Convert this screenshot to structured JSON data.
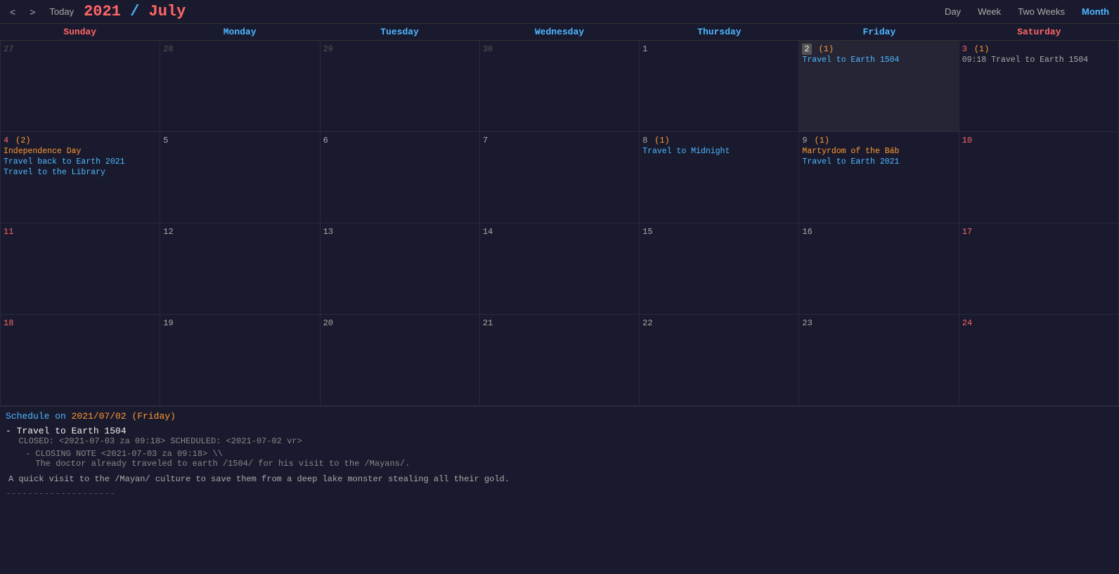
{
  "header": {
    "title_year": "2021",
    "title_sep": " / ",
    "title_month": "July",
    "nav_prev": "<",
    "nav_next": ">",
    "today_label": "Today",
    "views": [
      "Day",
      "Week",
      "Two Weeks",
      "Month"
    ],
    "active_view": "Month"
  },
  "day_headers": [
    {
      "label": "Sunday",
      "type": "sunday"
    },
    {
      "label": "Monday",
      "type": "weekday"
    },
    {
      "label": "Tuesday",
      "type": "weekday"
    },
    {
      "label": "Wednesday",
      "type": "weekday"
    },
    {
      "label": "Thursday",
      "type": "weekday"
    },
    {
      "label": "Friday",
      "type": "weekday"
    },
    {
      "label": "Saturday",
      "type": "saturday"
    }
  ],
  "weeks": [
    {
      "days": [
        {
          "num": "27",
          "type": "prev-month",
          "events": []
        },
        {
          "num": "28",
          "type": "prev-month",
          "events": []
        },
        {
          "num": "29",
          "type": "prev-month",
          "events": []
        },
        {
          "num": "30",
          "type": "prev-month",
          "events": []
        },
        {
          "num": "1",
          "type": "thursday",
          "events": []
        },
        {
          "num": "2",
          "count": "(1)",
          "type": "friday-highlight",
          "events": [
            {
              "text": "Travel to Earth 1504",
              "style": "normal"
            }
          ]
        },
        {
          "num": "3",
          "count": "(1)",
          "type": "saturday",
          "events": [
            {
              "text": "09:18 Travel to Earth 1504",
              "style": "timed"
            }
          ]
        }
      ]
    },
    {
      "days": [
        {
          "num": "4",
          "count": "(2)",
          "type": "sunday",
          "events": [
            {
              "text": "Independence Day",
              "style": "holiday"
            },
            {
              "text": "Travel back to Earth 2021",
              "style": "normal"
            },
            {
              "text": "Travel to the Library",
              "style": "normal"
            }
          ]
        },
        {
          "num": "5",
          "type": "monday",
          "events": []
        },
        {
          "num": "6",
          "type": "tuesday",
          "events": []
        },
        {
          "num": "7",
          "type": "wednesday",
          "events": []
        },
        {
          "num": "8",
          "count": "(1)",
          "type": "thursday",
          "events": [
            {
              "text": "Travel to Midnight",
              "style": "normal"
            }
          ]
        },
        {
          "num": "9",
          "count": "(1)",
          "type": "friday",
          "events": [
            {
              "text": "Martyrdom of the Báb",
              "style": "holiday"
            },
            {
              "text": "Travel to Earth 2021",
              "style": "normal"
            }
          ]
        },
        {
          "num": "10",
          "type": "saturday",
          "events": []
        }
      ]
    },
    {
      "days": [
        {
          "num": "11",
          "type": "sunday",
          "events": []
        },
        {
          "num": "12",
          "type": "monday",
          "events": []
        },
        {
          "num": "13",
          "type": "tuesday",
          "events": []
        },
        {
          "num": "14",
          "type": "wednesday",
          "events": []
        },
        {
          "num": "15",
          "type": "thursday",
          "events": []
        },
        {
          "num": "16",
          "type": "friday",
          "events": []
        },
        {
          "num": "17",
          "type": "saturday",
          "events": []
        }
      ]
    },
    {
      "days": [
        {
          "num": "18",
          "type": "sunday",
          "events": []
        },
        {
          "num": "19",
          "type": "monday",
          "events": []
        },
        {
          "num": "20",
          "type": "tuesday",
          "events": []
        },
        {
          "num": "21",
          "type": "wednesday",
          "events": []
        },
        {
          "num": "22",
          "type": "thursday",
          "events": []
        },
        {
          "num": "23",
          "type": "friday",
          "events": []
        },
        {
          "num": "24",
          "type": "saturday",
          "events": []
        }
      ]
    }
  ],
  "schedule": {
    "title": "Schedule on 2021/07/02 (Friday)",
    "entries": [
      {
        "title": "- Travel to Earth 1504",
        "meta": "CLOSED: <2021-07-03 za 09:18> SCHEDULED: <2021-07-02 vr>",
        "note": "- CLOSING NOTE <2021-07-03 za 09:18> \\\\",
        "note2": "  The doctor already traveled to earth /1504/ for his visit to the /Mayans/.",
        "desc": "A quick visit to the /Mayan/ culture to save them from a deep lake monster stealing all their gold."
      }
    ],
    "separator": "--------------------"
  }
}
